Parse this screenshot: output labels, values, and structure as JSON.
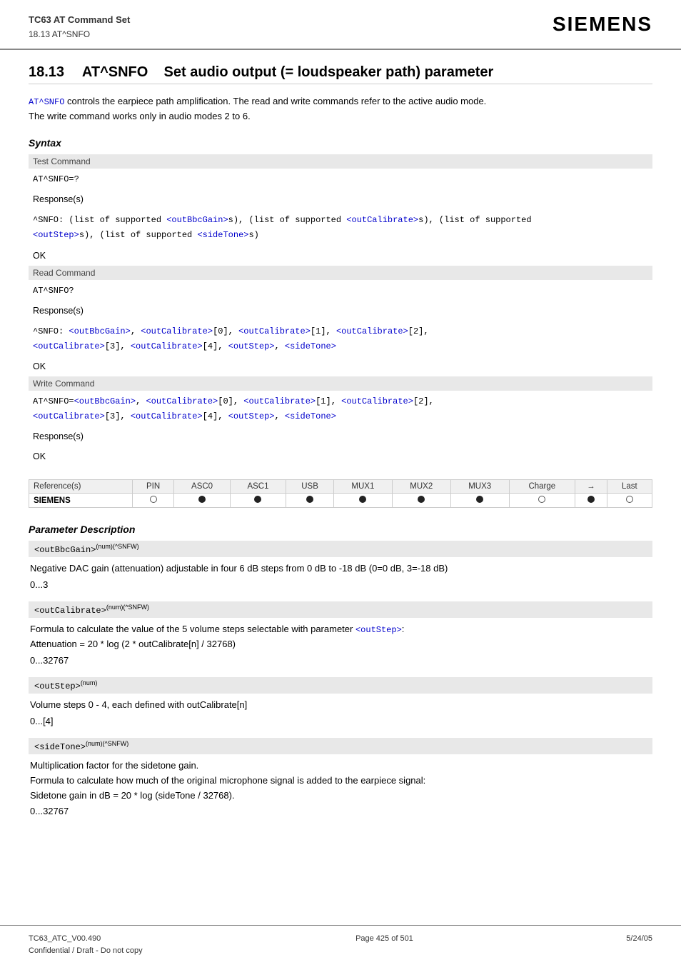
{
  "header": {
    "doc_title": "TC63 AT Command Set",
    "section_ref": "18.13 AT^SNFO",
    "logo": "SIEMENS"
  },
  "section": {
    "number": "18.13",
    "title": "AT^SNFO",
    "subtitle": "Set audio output (= loudspeaker path) parameter"
  },
  "intro": {
    "text1": "AT^SNFO controls the earpiece path amplification. The read and write commands refer to the active audio mode.",
    "text2": "The write command works only in audio modes 2 to 6.",
    "code_link": "AT^SNFO"
  },
  "syntax_heading": "Syntax",
  "commands": [
    {
      "section_label": "Test Command",
      "command": "AT^SNFO=?",
      "response_label": "Response(s)",
      "response": "^SNFO: (list of supported <outBbcGain>s), (list of supported <outCalibrate>s), (list of supported <outStep>s), (list of supported <sideTone>s)",
      "ok": "OK"
    },
    {
      "section_label": "Read Command",
      "command": "AT^SNFO?",
      "response_label": "Response(s)",
      "response": "^SNFO: <outBbcGain>, <outCalibrate>[0], <outCalibrate>[1], <outCalibrate>[2], <outCalibrate>[3], <outCalibrate>[4], <outStep>, <sideTone>",
      "ok": "OK"
    },
    {
      "section_label": "Write Command",
      "command": "AT^SNFO=<outBbcGain>, <outCalibrate>[0], <outCalibrate>[1], <outCalibrate>[2], <outCalibrate>[3], <outCalibrate>[4], <outStep>, <sideTone>",
      "response_label": "Response(s)",
      "ok": "OK"
    }
  ],
  "reference_table": {
    "header": [
      "Reference(s)",
      "PIN",
      "ASC0",
      "ASC1",
      "USB",
      "MUX1",
      "MUX2",
      "MUX3",
      "Charge",
      "→",
      "Last"
    ],
    "row_label": "SIEMENS",
    "dots": [
      "empty",
      "filled",
      "filled",
      "filled",
      "filled",
      "filled",
      "filled",
      "empty",
      "filled",
      "empty"
    ]
  },
  "param_description_heading": "Parameter Description",
  "parameters": [
    {
      "name": "<outBbcGain>",
      "superscript": "(num)(^SNFW)",
      "desc": "Negative DAC gain (attenuation) adjustable in four 6 dB steps from 0 dB to -18 dB (0=0 dB, 3=-18 dB)",
      "range": "0...3"
    },
    {
      "name": "<outCalibrate>",
      "superscript": "(num)(^SNFW)",
      "desc": "Formula to calculate the value of the 5 volume steps selectable with parameter <outStep>:\nAttenuation = 20 * log (2 * outCalibrate[n] / 32768)",
      "range": "0...32767"
    },
    {
      "name": "<outStep>",
      "superscript": "(num)",
      "desc": "Volume steps 0 - 4, each defined with outCalibrate[n]",
      "range": "0...[4]"
    },
    {
      "name": "<sideTone>",
      "superscript": "(num)(^SNFW)",
      "desc": "Multiplication factor for the sidetone gain.\nFormula to calculate how much of the original microphone signal is added to the earpiece signal:\nSidetone gain in dB = 20 * log (sideTone / 32768).",
      "range": "0...32767"
    }
  ],
  "footer": {
    "left_line1": "TC63_ATC_V00.490",
    "left_line2": "Confidential / Draft - Do not copy",
    "center": "Page 425 of 501",
    "right": "5/24/05"
  }
}
